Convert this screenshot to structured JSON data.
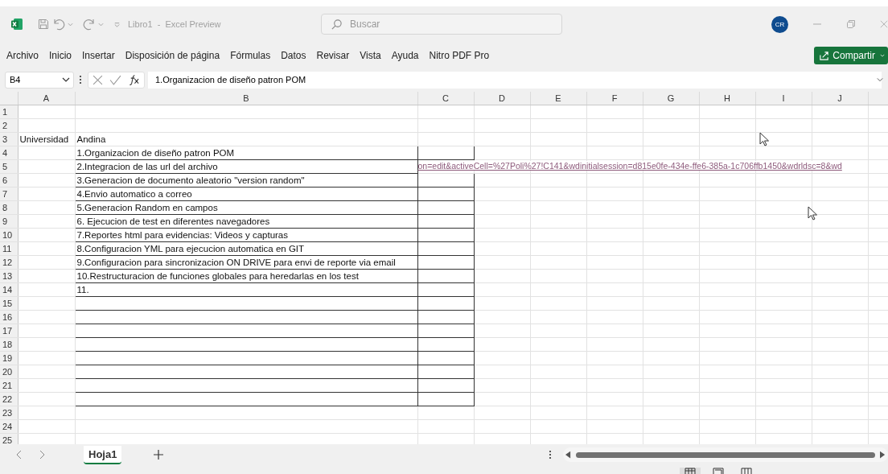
{
  "window": {
    "title": "Libro1  -  Excel Preview",
    "avatar": "CR"
  },
  "search": {
    "placeholder": "Buscar"
  },
  "ribbon_tabs": [
    {
      "label": "Archivo",
      "selected": false
    },
    {
      "label": "Inicio",
      "selected": false
    },
    {
      "label": "Insertar",
      "selected": false
    },
    {
      "label": "Disposición de página",
      "selected": false
    },
    {
      "label": "Fórmulas",
      "selected": false
    },
    {
      "label": "Datos",
      "selected": false
    },
    {
      "label": "Revisar",
      "selected": false
    },
    {
      "label": "Vista",
      "selected": false
    },
    {
      "label": "Ayuda",
      "selected": false
    },
    {
      "label": "Nitro PDF Pro",
      "selected": false
    }
  ],
  "share_button": "Compartir",
  "formula_bar": {
    "name_box": "B4",
    "formula": "1.Organizacion de diseño patron POM"
  },
  "sheet": {
    "columns": [
      "A",
      "B",
      "C",
      "D",
      "E",
      "F",
      "G",
      "H",
      "I",
      "J"
    ],
    "rows": [
      {
        "number": "1",
        "boxed": false
      },
      {
        "number": "2",
        "boxed": false
      },
      {
        "number": "3",
        "boxed": false,
        "A": "Universidad",
        "B": "Andina"
      },
      {
        "number": "4",
        "boxed": true,
        "B": "1.Organizacion de diseño patron POM"
      },
      {
        "number": "5",
        "boxed": true,
        "B": "2.Integracion de las url del archivo",
        "link": "on=edit&activeCell=%27Poli%27!C141&wdinitialsession=d815e0fe-434e-ffe6-385a-1c706ffb1450&wdrldsc=8&wd"
      },
      {
        "number": "6",
        "boxed": true,
        "B": "3.Generacion de documento aleatorio \"version random\""
      },
      {
        "number": "7",
        "boxed": true,
        "B": "4.Envio automatico a correo"
      },
      {
        "number": "8",
        "boxed": true,
        "B": "5.Generacion Random en campos"
      },
      {
        "number": "9",
        "boxed": true,
        "B": "6. Ejecucion de test en diferentes navegadores"
      },
      {
        "number": "10",
        "boxed": true,
        "B": "7.Reportes html para evidencias: Videos y capturas"
      },
      {
        "number": "11",
        "boxed": true,
        "B": "8.Configuracion YML para ejecucion automatica en GIT"
      },
      {
        "number": "12",
        "boxed": true,
        "B": "9.Configuracion para sincronizacion ON DRIVE para envi de reporte via email"
      },
      {
        "number": "13",
        "boxed": true,
        "B": "10.Restructuracion de funciones globales para heredarlas en los test"
      },
      {
        "number": "14",
        "boxed": true,
        "B": "11."
      },
      {
        "number": "15",
        "boxed": true
      },
      {
        "number": "16",
        "boxed": true
      },
      {
        "number": "17",
        "boxed": true
      },
      {
        "number": "18",
        "boxed": true
      },
      {
        "number": "19",
        "boxed": true
      },
      {
        "number": "20",
        "boxed": true
      },
      {
        "number": "21",
        "boxed": true
      },
      {
        "number": "22",
        "boxed": true
      },
      {
        "number": "23",
        "boxed": false
      },
      {
        "number": "24",
        "boxed": false
      },
      {
        "number": "25",
        "boxed": false
      }
    ]
  },
  "sheet_tabs": [
    {
      "label": "Hoja1",
      "selected": true
    }
  ]
}
